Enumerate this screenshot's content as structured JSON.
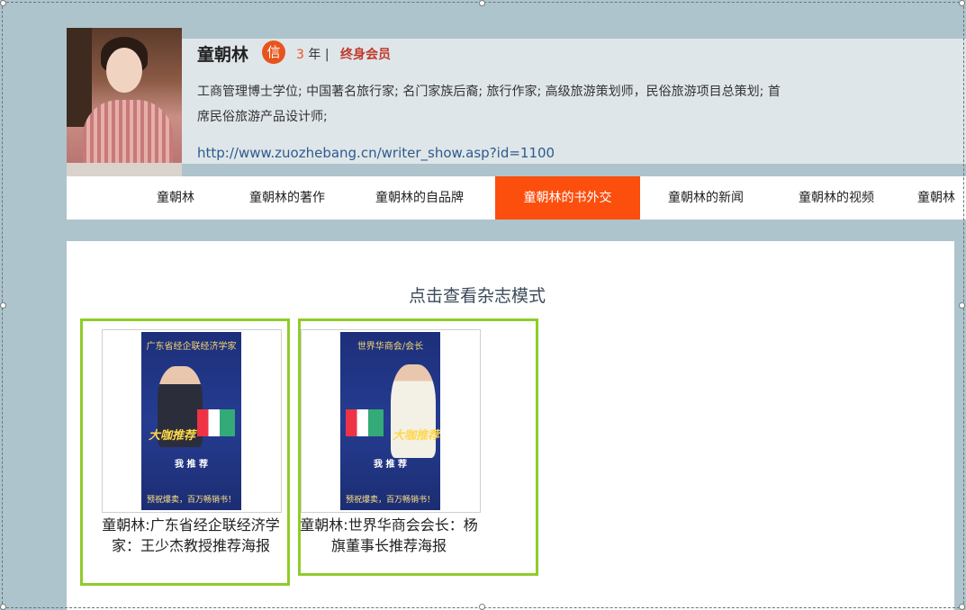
{
  "profile": {
    "name": "童朝林",
    "badge": "信",
    "years_num": "3",
    "years_suffix": " 年 |",
    "member": "终身会员",
    "bio": "工商管理博士学位; 中国著名旅行家; 名门家族后裔; 旅行作家; 高级旅游策划师，民俗旅游项目总策划; 首席民俗旅游产品设计师;",
    "url": "http://www.zuozhebang.cn/writer_show.asp?id=1100"
  },
  "nav": {
    "items": [
      {
        "label": "童朝林"
      },
      {
        "label": "童朝林的著作"
      },
      {
        "label": "童朝林的自品牌"
      },
      {
        "label": "童朝林的书外交"
      },
      {
        "label": "童朝林的新闻"
      },
      {
        "label": "童朝林的视频"
      },
      {
        "label": "童朝林"
      }
    ],
    "active_index": 3
  },
  "main": {
    "magazine_link": "点击查看杂志模式",
    "cards": [
      {
        "poster_title": "广东省经企联经济学家",
        "poster_tag": "大咖推荐",
        "poster_rec": "我 推 荐",
        "poster_bottom": "预祝爆卖，百万畅销书！",
        "caption": "童朝林:广东省经企联经济学家：王少杰教授推荐海报"
      },
      {
        "poster_title": "世界华商会/会长",
        "poster_tag": "大咖推荐",
        "poster_rec": "我 推 荐",
        "poster_bottom": "预祝爆卖，百万畅销书！",
        "caption": "童朝林:世界华商会会长：杨旗董事长推荐海报"
      }
    ]
  },
  "colors": {
    "accent": "#fc4f0e",
    "card_border": "#8fcc2a",
    "background": "#aec4cc"
  }
}
